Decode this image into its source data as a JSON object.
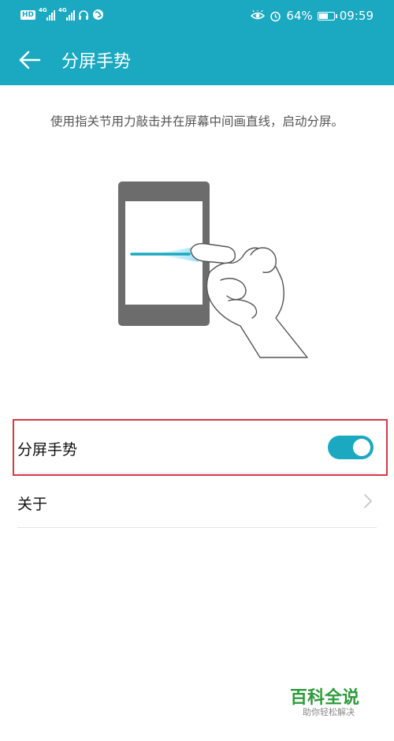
{
  "status_bar": {
    "left_badge": "HD",
    "signal1_tag": "4G",
    "signal2_tag": "4G",
    "battery_percent": "64%",
    "battery_level": 0.64,
    "time": "09:59"
  },
  "app_bar": {
    "title": "分屏手势"
  },
  "description": "使用指关节用力敲击并在屏幕中间画直线，启动分屏。",
  "settings": {
    "split_gesture": {
      "label": "分屏手势",
      "enabled": true
    },
    "about": {
      "label": "关于"
    }
  },
  "watermark": {
    "main": "百科全说",
    "sub": "助你轻松解决"
  },
  "colors": {
    "accent": "#1aa9c0",
    "highlight_border": "#d23a45",
    "watermark": "#2e9b3c"
  }
}
